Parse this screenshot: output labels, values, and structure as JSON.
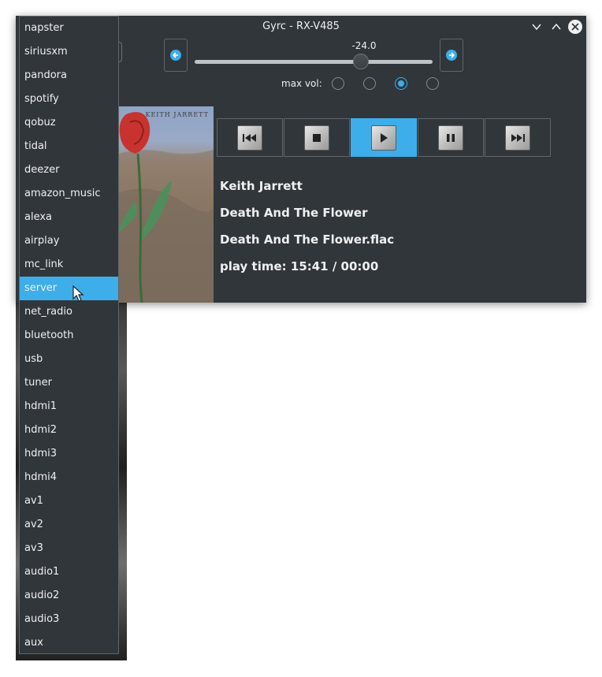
{
  "window": {
    "title": "Gyrc - RX-V485"
  },
  "titlebar": {
    "minimize_icon": "chevron-down-icon",
    "maximize_icon": "chevron-up-icon",
    "close_icon": "close-icon"
  },
  "volume": {
    "value": "-24.0",
    "level_fraction": 0.7,
    "decrease_icon": "arrow-left-icon",
    "increase_icon": "arrow-right-icon"
  },
  "max_vol": {
    "label": "max vol:",
    "options_count": 4,
    "selected_index": 2
  },
  "playback_controls": [
    "skip-previous-icon",
    "stop-icon",
    "play-icon",
    "pause-icon",
    "skip-next-icon"
  ],
  "active_control": "play-icon",
  "now_playing": {
    "album_cover_text": "KEITH JARRETT",
    "artist": "Keith Jarrett",
    "album": "Death And The Flower",
    "file": "Death And The Flower.flac",
    "play_time": "play time:  15:41 / 00:00"
  },
  "source_dropdown": {
    "selected": "server",
    "items": [
      "napster",
      "siriusxm",
      "pandora",
      "spotify",
      "qobuz",
      "tidal",
      "deezer",
      "amazon_music",
      "alexa",
      "airplay",
      "mc_link",
      "server",
      "net_radio",
      "bluetooth",
      "usb",
      "tuner",
      "hdmi1",
      "hdmi2",
      "hdmi3",
      "hdmi4",
      "av1",
      "av2",
      "av3",
      "audio1",
      "audio2",
      "audio3",
      "aux"
    ]
  },
  "colors": {
    "accent": "#3daee9",
    "window_bg": "#31363b",
    "text": "#eff0f1"
  }
}
